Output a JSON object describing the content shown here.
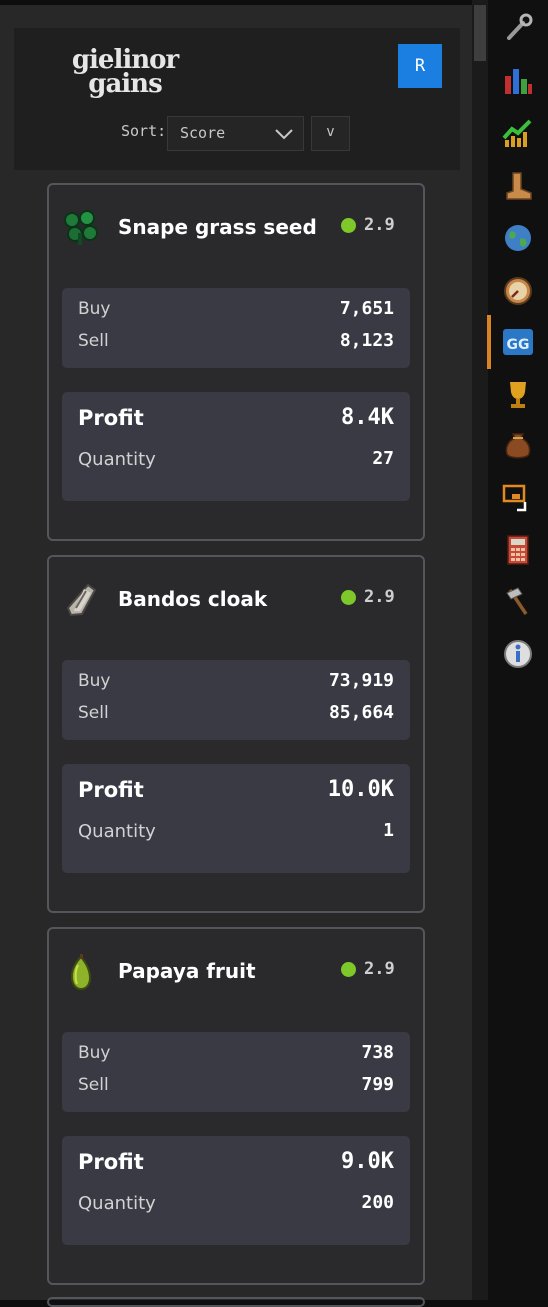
{
  "app": {
    "logo": {
      "line1": "gielinor",
      "line2": "gains"
    },
    "refresh_label": "R"
  },
  "sort": {
    "label": "Sort:",
    "selected": "Score",
    "direction": "v"
  },
  "items": [
    {
      "name": "Snape grass seed",
      "icon": "snape-grass-seed-icon",
      "score": "2.9",
      "buy_label": "Buy",
      "buy": "7,651",
      "sell_label": "Sell",
      "sell": "8,123",
      "profit_label": "Profit",
      "profit": "8.4K",
      "quantity_label": "Quantity",
      "quantity": "27"
    },
    {
      "name": "Bandos cloak",
      "icon": "bandos-cloak-icon",
      "score": "2.9",
      "buy_label": "Buy",
      "buy": "73,919",
      "sell_label": "Sell",
      "sell": "85,664",
      "profit_label": "Profit",
      "profit": "10.0K",
      "quantity_label": "Quantity",
      "quantity": "1"
    },
    {
      "name": "Papaya fruit",
      "icon": "papaya-fruit-icon",
      "score": "2.9",
      "buy_label": "Buy",
      "buy": "738",
      "sell_label": "Sell",
      "sell": "799",
      "profit_label": "Profit",
      "profit": "9.0K",
      "quantity_label": "Quantity",
      "quantity": "200"
    }
  ],
  "sidebar": {
    "icons": [
      "wrench-icon",
      "bar-chart-icon",
      "trend-up-icon",
      "boot-icon",
      "globe-icon",
      "compass-icon",
      "gielinor-gains-icon",
      "trophy-icon",
      "loot-bag-icon",
      "screenshot-icon",
      "calculator-icon",
      "hammer-icon",
      "info-icon"
    ],
    "active_icon": "gielinor-gains-icon"
  },
  "colors": {
    "accent_blue": "#1a7fe0",
    "score_dot": "#7ec82a",
    "active_nav": "#d98324"
  }
}
